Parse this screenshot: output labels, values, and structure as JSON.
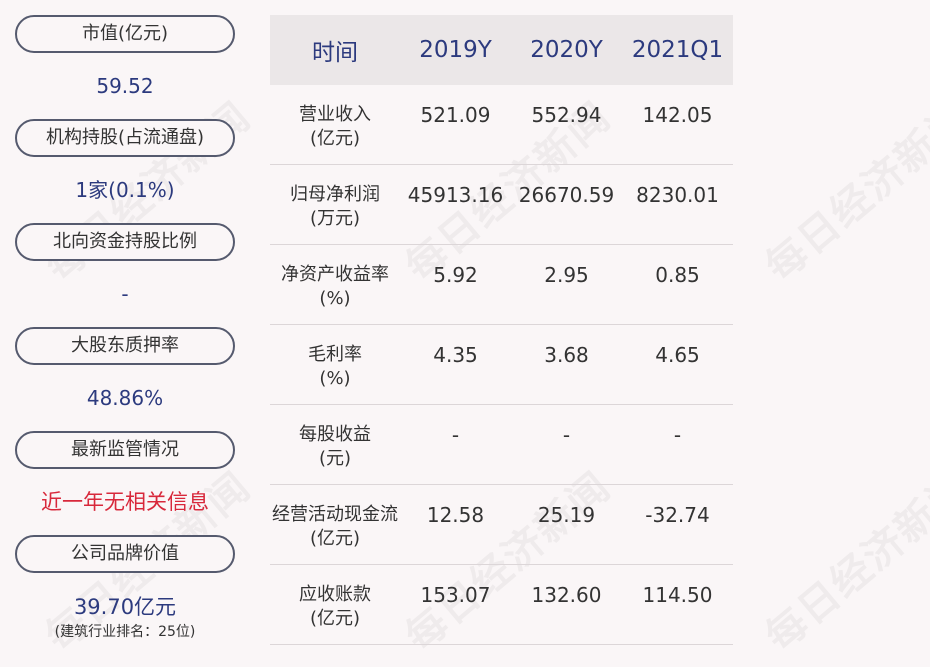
{
  "metrics": [
    {
      "label": "市值(亿元)",
      "value": "59.52"
    },
    {
      "label": "机构持股(占流通盘)",
      "value": "1家(0.1%)"
    },
    {
      "label": "北向资金持股比例",
      "value": "-"
    },
    {
      "label": "大股东质押率",
      "value": "48.86%"
    },
    {
      "label": "最新监管情况",
      "value": "近一年无相关信息"
    },
    {
      "label": "公司品牌价值",
      "value": "39.70亿元",
      "note": "(建筑行业排名：25位)"
    }
  ],
  "table": {
    "headers": [
      "时间",
      "2019Y",
      "2020Y",
      "2021Q1"
    ],
    "rows": [
      {
        "name": "营业收入",
        "unit": "(亿元)",
        "values": [
          "521.09",
          "552.94",
          "142.05"
        ]
      },
      {
        "name": "归母净利润",
        "unit": "(万元)",
        "values": [
          "45913.16",
          "26670.59",
          "8230.01"
        ]
      },
      {
        "name": "净资产收益率",
        "unit": "(%)",
        "values": [
          "5.92",
          "2.95",
          "0.85"
        ]
      },
      {
        "name": "毛利率",
        "unit": "(%)",
        "values": [
          "4.35",
          "3.68",
          "4.65"
        ]
      },
      {
        "name": "每股收益",
        "unit": "(元)",
        "values": [
          "-",
          "-",
          "-"
        ]
      },
      {
        "name": "经营活动现金流",
        "unit": "(亿元)",
        "values": [
          "12.58",
          "25.19",
          "-32.74"
        ]
      },
      {
        "name": "应收账款",
        "unit": "(亿元)",
        "values": [
          "153.07",
          "132.60",
          "114.50"
        ]
      }
    ]
  },
  "watermark": "每日经济新闻",
  "colors": {
    "value_blue": "#2c3a7e",
    "alert_red": "#d8283b",
    "header_bg": "#ebe7e8"
  }
}
